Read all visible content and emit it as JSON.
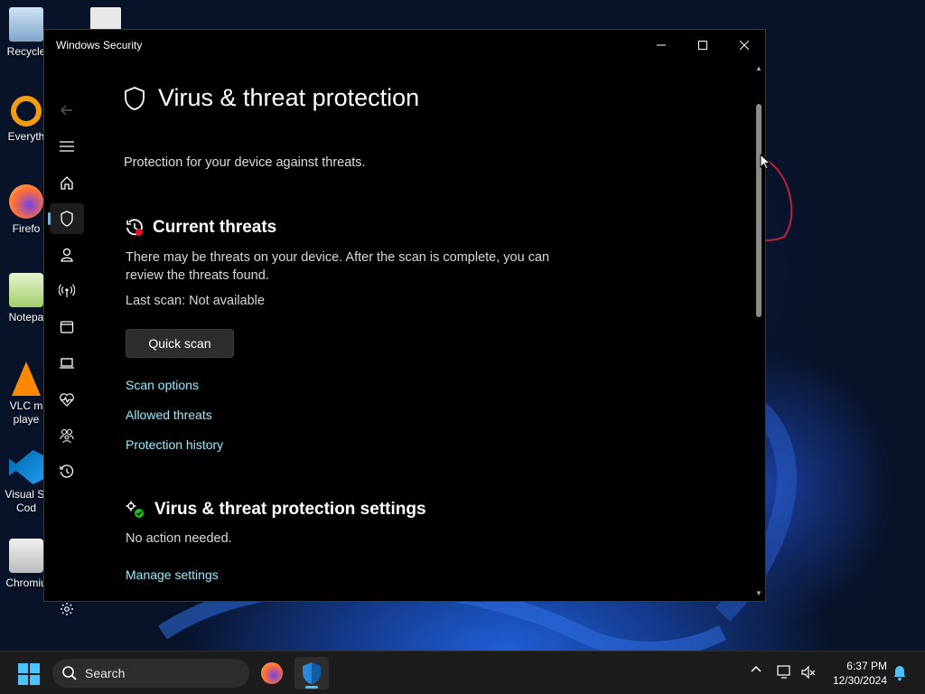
{
  "window": {
    "title": "Windows Security",
    "minimize_icon": "minimize-icon",
    "maximize_icon": "maximize-icon",
    "close_icon": "close-icon"
  },
  "nav": {
    "items": [
      {
        "icon": "back-arrow-icon"
      },
      {
        "icon": "hamburger-menu-icon"
      },
      {
        "icon": "home-icon"
      },
      {
        "icon": "shield-icon",
        "active": true
      },
      {
        "icon": "person-icon"
      },
      {
        "icon": "antenna-icon"
      },
      {
        "icon": "app-browser-icon"
      },
      {
        "icon": "laptop-icon"
      },
      {
        "icon": "heart-pulse-icon"
      },
      {
        "icon": "family-icon"
      },
      {
        "icon": "history-icon"
      },
      {
        "icon": "gear-icon"
      }
    ]
  },
  "page": {
    "title": "Virus & threat protection",
    "subtitle": "Protection for your device against threats."
  },
  "current_threats": {
    "heading": "Current threats",
    "description": "There may be threats on your device. After the scan is complete, you can review the threats found.",
    "last_scan": "Last scan: Not available",
    "quick_scan_label": "Quick scan",
    "links": [
      "Scan options",
      "Allowed threats",
      "Protection history"
    ]
  },
  "settings_section": {
    "heading": "Virus & threat protection settings",
    "status": "No action needed.",
    "manage_link": "Manage settings"
  },
  "desktop_icons": [
    {
      "label": "Recycle",
      "icon": "recycle-bin-icon"
    },
    {
      "label": "Everyth",
      "icon": "everything-search-icon"
    },
    {
      "label": "Firefo",
      "icon": "firefox-icon"
    },
    {
      "label": "Notepa",
      "icon": "notepad-icon"
    },
    {
      "label": "VLC m\nplaye",
      "icon": "vlc-icon"
    },
    {
      "label": "Visual St\nCod",
      "icon": "vscode-icon"
    },
    {
      "label": "Chromiu",
      "icon": "chromium-icon"
    }
  ],
  "taskbar": {
    "search_placeholder": "Search",
    "time": "6:37 PM",
    "date": "12/30/2024"
  },
  "colors": {
    "accent": "#4cc2ff",
    "link": "#99ebff",
    "window_bg": "#000000",
    "taskbar_bg": "#1c1c1c"
  }
}
